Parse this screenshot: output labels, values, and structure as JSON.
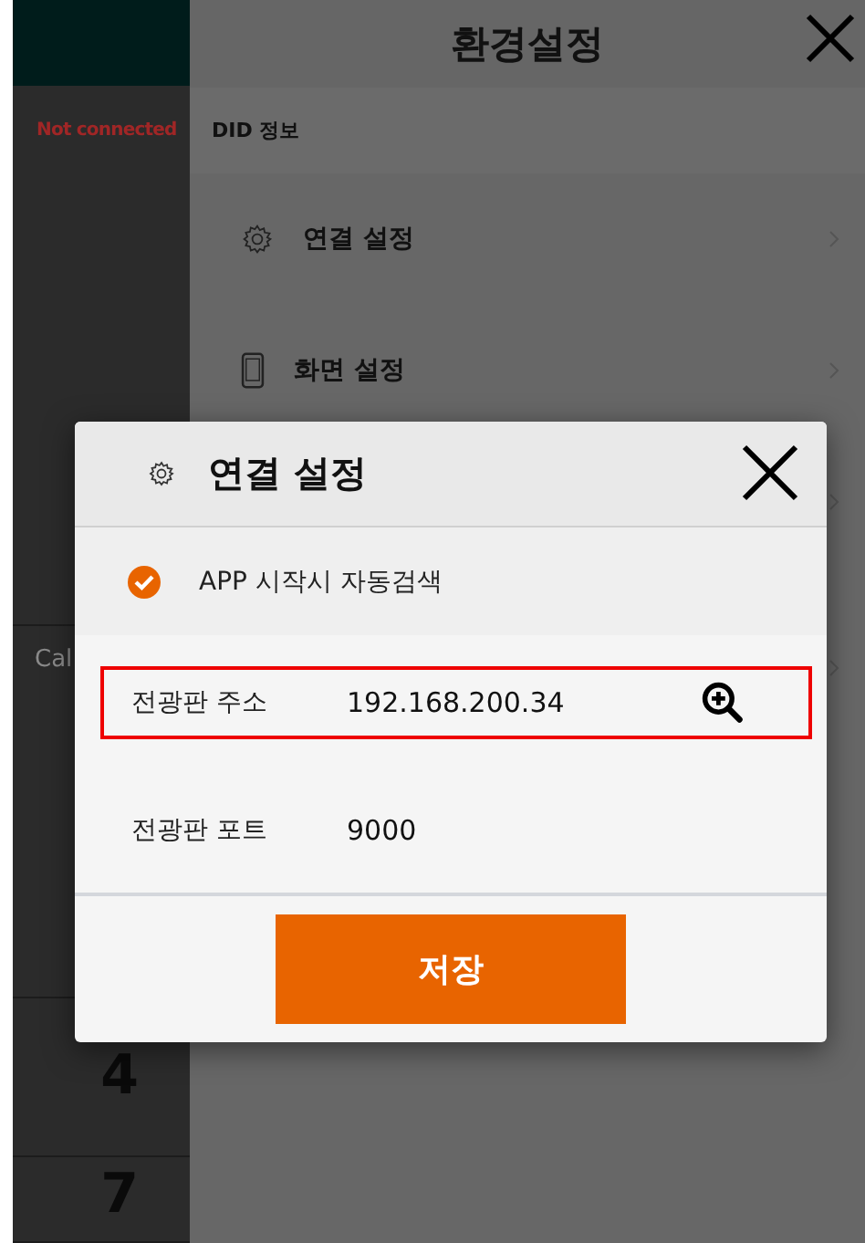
{
  "left_panel": {
    "status": "Not connected",
    "rows": [
      "Cal",
      "4",
      "7"
    ]
  },
  "settings": {
    "title": "환경설정",
    "section": "DID 정보",
    "items": [
      {
        "label": "연결 설정",
        "kind": "gear"
      },
      {
        "label": "화면 설정",
        "kind": "phone"
      }
    ]
  },
  "dialog": {
    "title": "연결 설정",
    "auto_search": {
      "label": "APP 시작시 자동검색",
      "checked": true
    },
    "fields": [
      {
        "label": "전광판 주소",
        "value": "192.168.200.34",
        "highlighted": true,
        "kind": "search"
      },
      {
        "label": "전광판 포트",
        "value": "9000",
        "highlighted": false,
        "kind": "plain"
      }
    ],
    "save_button": "저장"
  }
}
